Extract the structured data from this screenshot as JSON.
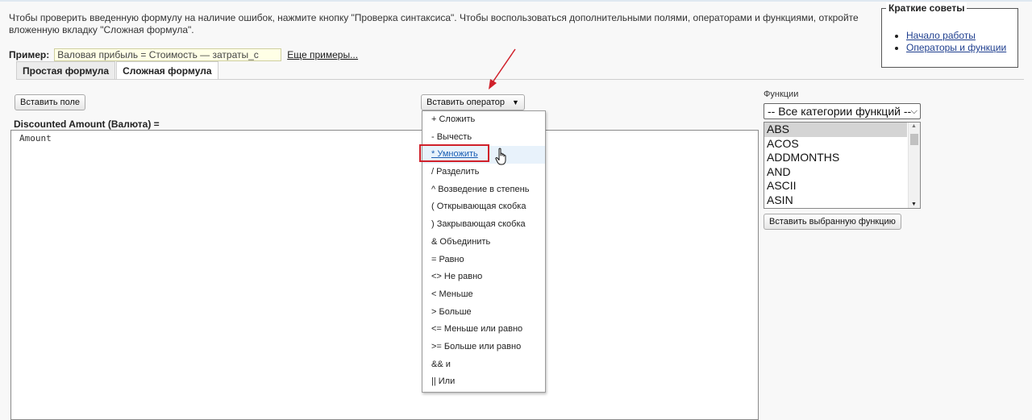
{
  "intro": {
    "text": "Чтобы проверить введенную формулу на наличие ошибок, нажмите кнопку \"Проверка синтаксиса\". Чтобы воспользоваться дополнительными полями, операторами и функциями, откройте вложенную вкладку \"Сложная формула\"."
  },
  "example": {
    "label": "Пример:",
    "value": "Валовая прибыль = Стоимость — затраты_с",
    "more_link": "Еще примеры..."
  },
  "tips": {
    "title": "Краткие советы",
    "links": [
      "Начало работы",
      "Операторы и функции"
    ]
  },
  "tabs": [
    "Простая формула",
    "Сложная формула"
  ],
  "active_tab": "Сложная формула",
  "toolbar": {
    "insert_field": "Вставить поле",
    "insert_operator": "Вставить оператор"
  },
  "formula": {
    "label": "Discounted Amount (Валюта) =",
    "value": "Amount"
  },
  "operator_menu": {
    "items": [
      "+ Сложить",
      "- Вычесть",
      "* Умножить",
      "/ Разделить",
      "^ Возведение в степень",
      "( Открывающая скобка",
      ") Закрывающая скобка",
      "& Объединить",
      "= Равно",
      "<> Не равно",
      "< Меньше",
      "> Больше",
      "<= Меньше или равно",
      ">= Больше или равно",
      "&& и",
      "|| Или"
    ],
    "hovered": "* Умножить"
  },
  "functions": {
    "label": "Функции",
    "category_selected": "-- Все категории функций --",
    "list": [
      "ABS",
      "ACOS",
      "ADDMONTHS",
      "AND",
      "ASCII",
      "ASIN"
    ],
    "selected": "ABS",
    "insert_button": "Вставить выбранную функцию"
  },
  "colors": {
    "annotation_red": "#d0202a",
    "link_blue": "#1f3f8f",
    "example_bg": "#ffffe6"
  },
  "icons": [
    "pointer-hand-cursor-icon",
    "red-arrow-annotation-icon",
    "dropdown-caret-icon",
    "scroll-up-arrow-icon",
    "scroll-down-arrow-icon"
  ]
}
